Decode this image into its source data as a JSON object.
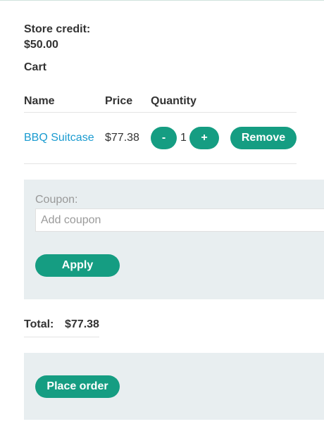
{
  "store_credit": {
    "label": "Store credit:",
    "amount": "$50.00"
  },
  "cart": {
    "heading": "Cart",
    "columns": [
      "Name",
      "Price",
      "Quantity"
    ],
    "items": [
      {
        "name": "BBQ Suitcase",
        "price": "$77.38",
        "quantity": "1",
        "decrement_label": "-",
        "increment_label": "+",
        "remove_label": "Remove"
      }
    ]
  },
  "coupon": {
    "label": "Coupon:",
    "placeholder": "Add coupon",
    "apply_label": "Apply"
  },
  "total": {
    "label": "Total:",
    "value": "$77.38"
  },
  "order": {
    "place_order_label": "Place order"
  },
  "colors": {
    "accent": "#159d82",
    "link": "#1a9bd0",
    "panel_bg": "#e8eef0",
    "text": "#333333"
  }
}
